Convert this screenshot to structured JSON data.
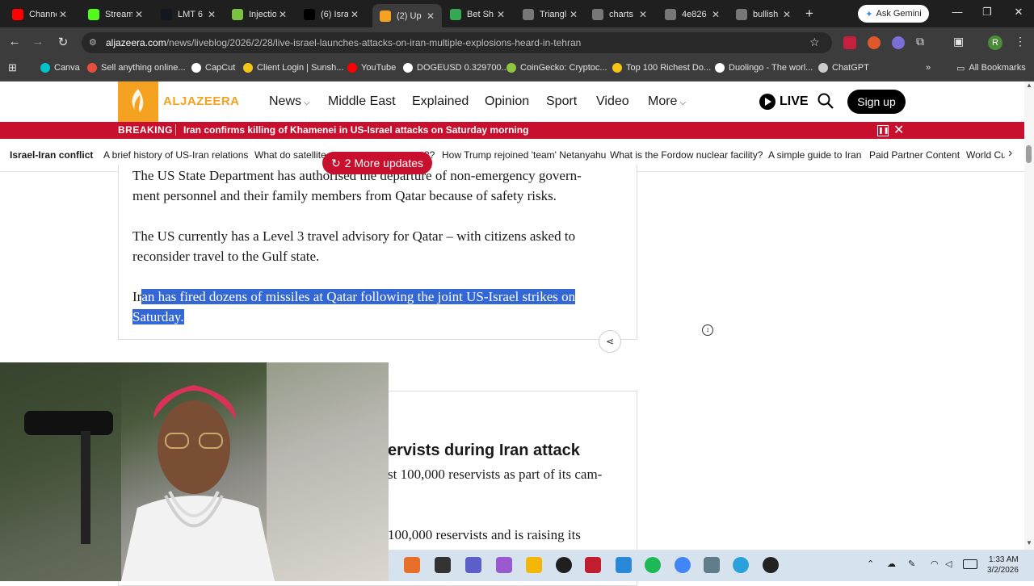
{
  "browser": {
    "tabs": [
      {
        "title": "Channe",
        "icon": "youtube-icon",
        "color": "#ff0000",
        "active": false
      },
      {
        "title": "Stream",
        "icon": "kick-icon",
        "color": "#53fc18",
        "active": false
      },
      {
        "title": "LMT 6",
        "icon": "tradingview-icon",
        "color": "#131722",
        "active": false
      },
      {
        "title": "Injectio",
        "icon": "globe-icon",
        "color": "#7cc242",
        "active": false
      },
      {
        "title": "(6) Isra",
        "icon": "x-icon",
        "color": "#000000",
        "active": false
      },
      {
        "title": "(2) Up",
        "icon": "aljazeera-icon",
        "color": "#f4a21f",
        "active": true
      },
      {
        "title": "Bet Sh",
        "icon": "maps-icon",
        "color": "#34a853",
        "active": false
      },
      {
        "title": "Triangl",
        "icon": "globe-icon",
        "color": "#777777",
        "active": false
      },
      {
        "title": "charts",
        "icon": "globe-icon",
        "color": "#777777",
        "active": false
      },
      {
        "title": "4e826",
        "icon": "globe-icon",
        "color": "#777777",
        "active": false
      },
      {
        "title": "bullish",
        "icon": "globe-icon",
        "color": "#777777",
        "active": false
      }
    ],
    "gemini_label": "Ask Gemini",
    "url_domain": "aljazeera.com",
    "url_path": "/news/liveblog/2026/2/28/live-israel-launches-attacks-on-iran-multiple-explosions-heard-in-tehran",
    "profile_initial": "R",
    "bookmarks": [
      {
        "label": "Canva",
        "color": "#00c4cc"
      },
      {
        "label": "Sell anything online...",
        "color": "#e94e3c"
      },
      {
        "label": "CapCut",
        "color": "#ffffff"
      },
      {
        "label": "Client Login | Sunsh...",
        "color": "#f5c518"
      },
      {
        "label": "YouTube",
        "color": "#ff0000"
      },
      {
        "label": "DOGEUSD 0.329700...",
        "color": "#ffffff"
      },
      {
        "label": "CoinGecko: Cryptoc...",
        "color": "#8dc63f"
      },
      {
        "label": "Top 100 Richest Do...",
        "color": "#f5c518"
      },
      {
        "label": "Duolingo - The worl...",
        "color": "#ffffff"
      },
      {
        "label": "ChatGPT",
        "color": "#cccccc"
      }
    ],
    "bookmarks_more": "»",
    "all_bookmarks": "All Bookmarks"
  },
  "site": {
    "logo_text": "ALJAZEERA",
    "nav": [
      "News",
      "Middle East",
      "Explained",
      "Opinion",
      "Sport",
      "Video",
      "More"
    ],
    "live_label": "LIVE",
    "signup_label": "Sign up",
    "breaking_label": "BREAKING",
    "breaking_text": "Iran confirms killing of Khamenei in US-Israel attacks on Saturday morning",
    "topics": [
      "Israel-Iran conflict",
      "A brief history of US-Iran relations",
      "What do satellite",
      "2?",
      "How Trump rejoined 'team' Netanyahu",
      "What is the Fordow nuclear facility?",
      "A simple guide to Iran",
      "Paid Partner Content",
      "World Cu"
    ],
    "more_updates": "2 More updates",
    "p1_line1": "The US State Department has authorised the departure of non-emergency govern-",
    "p1_line2": "ment personnel and their family members from Qatar because of safety risks.",
    "p2_line1": "The US currently has a Level 3 travel advisory for Qatar – with citizens asked to",
    "p2_line2": "reconsider travel to the Gulf state.",
    "p3_lead": "Ir",
    "p3_hl1": "an has fired dozens of missiles at Qatar following the joint US-Israel strikes on",
    "p3_hl2": "Saturday.",
    "h2_partial": "ervists during Iran attack",
    "p4_line1": "st 100,000 reservists as part of its cam-",
    "p5_line1": "100,000 reservists and is raising its"
  },
  "taskbar": {
    "time": "1:33 AM",
    "date": "3/2/2026"
  }
}
